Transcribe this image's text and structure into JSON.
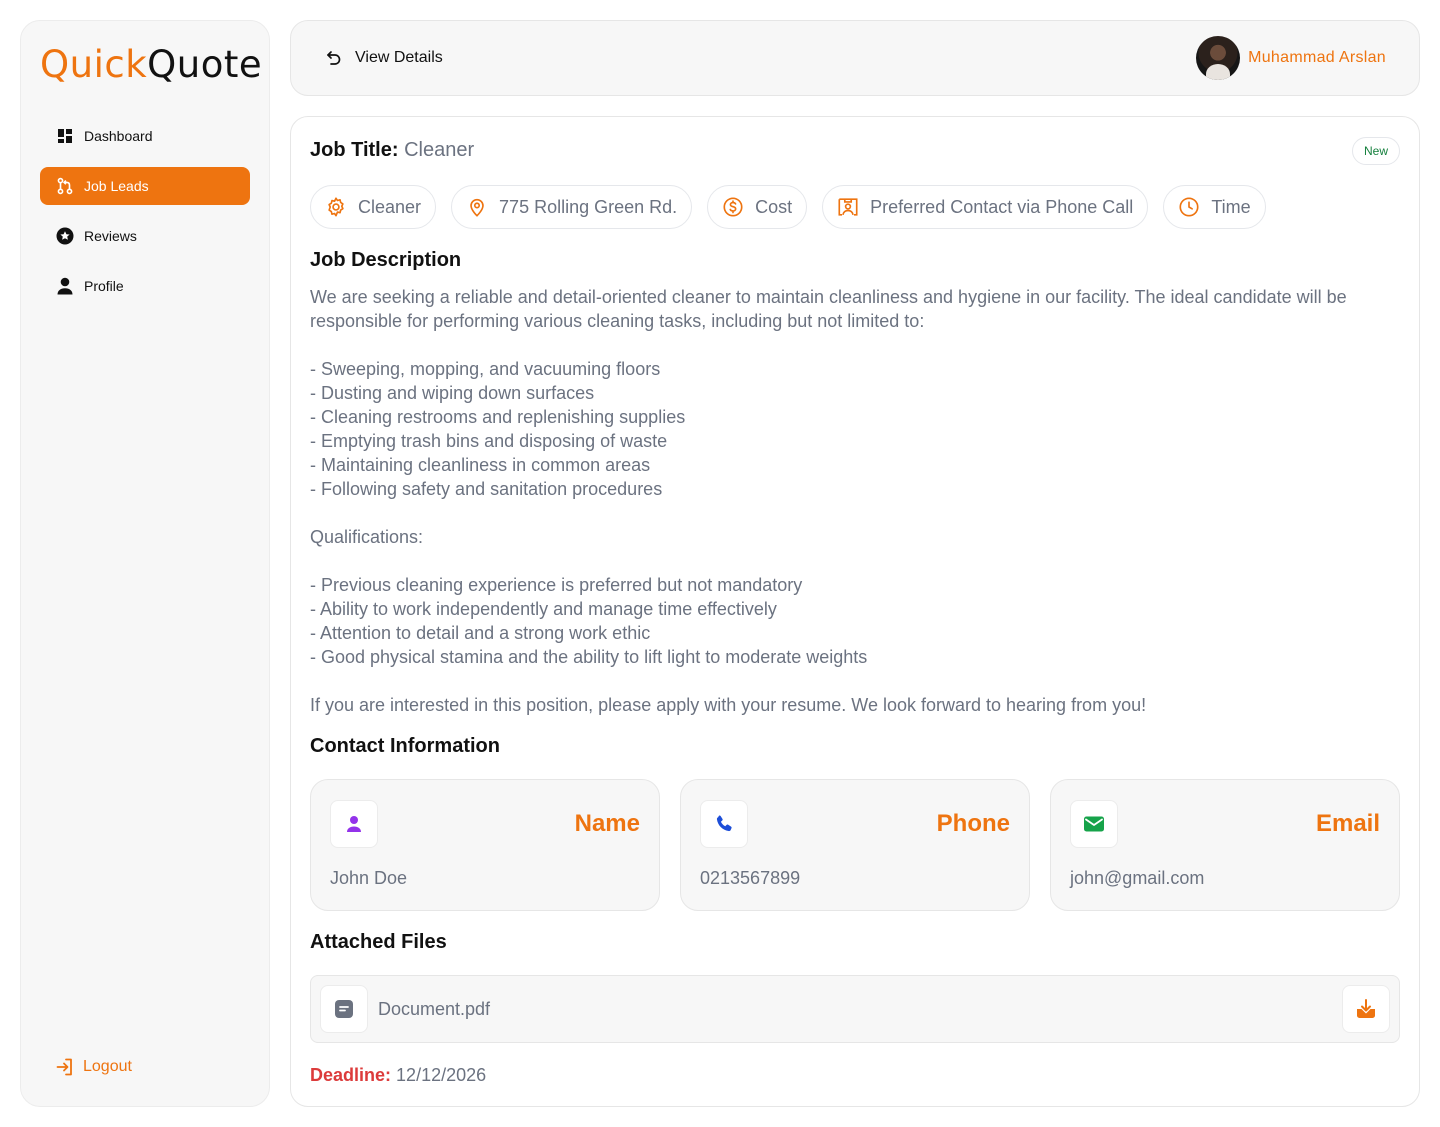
{
  "logo": {
    "part1": "Quick",
    "part2": "Quote"
  },
  "sidebar": {
    "items": [
      {
        "label": "Dashboard",
        "icon": "dashboard-icon",
        "active": false
      },
      {
        "label": "Job Leads",
        "icon": "job-leads-icon",
        "active": true
      },
      {
        "label": "Reviews",
        "icon": "star-icon",
        "active": false
      },
      {
        "label": "Profile",
        "icon": "user-icon",
        "active": false
      }
    ],
    "logout_label": "Logout"
  },
  "header": {
    "back_label": "View Details",
    "user_name": "Muhammad Arslan"
  },
  "job": {
    "title_label": "Job Title:",
    "title_value": "Cleaner",
    "badge": "New",
    "chips": [
      {
        "label": "Cleaner",
        "icon": "gear-icon"
      },
      {
        "label": "775 Rolling Green Rd.",
        "icon": "location-pin-icon"
      },
      {
        "label": "Cost",
        "icon": "dollar-icon"
      },
      {
        "label": "Preferred Contact via Phone Call",
        "icon": "contact-card-icon"
      },
      {
        "label": "Time",
        "icon": "clock-icon"
      }
    ],
    "description_title": "Job Description",
    "description": "We are seeking a reliable and detail-oriented cleaner to maintain cleanliness and hygiene in our facility. The ideal candidate will be responsible for performing various cleaning tasks, including but not limited to:\n\n- Sweeping, mopping, and vacuuming floors\n- Dusting and wiping down surfaces\n- Cleaning restrooms and replenishing supplies\n- Emptying trash bins and disposing of waste\n- Maintaining cleanliness in common areas\n- Following safety and sanitation procedures\n\nQualifications:\n\n- Previous cleaning experience is preferred but not mandatory\n- Ability to work independently and manage time effectively\n- Attention to detail and a strong work ethic\n- Good physical stamina and the ability to lift light to moderate weights\n\nIf you are interested in this position, please apply with your resume. We look forward to hearing from you!",
    "contact_title": "Contact Information",
    "contacts": [
      {
        "label": "Name",
        "value": "John Doe",
        "icon": "person-icon",
        "color": "#9333ea"
      },
      {
        "label": "Phone",
        "value": "0213567899",
        "icon": "phone-icon",
        "color": "#1d4ed8"
      },
      {
        "label": "Email",
        "value": "john@gmail.com",
        "icon": "mail-icon",
        "color": "#16a34a"
      }
    ],
    "files_title": "Attached Files",
    "file_name": "Document.pdf",
    "deadline_label": "Deadline:",
    "deadline_value": "12/12/2026"
  },
  "colors": {
    "accent": "#ee7410",
    "deadline": "#dc3b3b",
    "badge_text": "#15803d",
    "muted": "#6b7280"
  }
}
